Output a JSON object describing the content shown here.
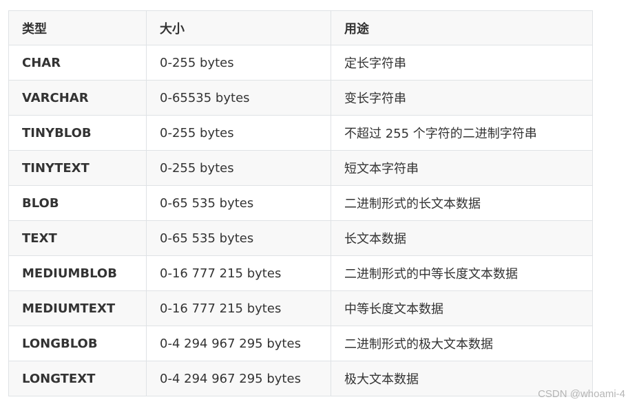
{
  "table": {
    "headers": [
      "类型",
      "大小",
      "用途"
    ],
    "rows": [
      {
        "type": "CHAR",
        "size": "0-255 bytes",
        "usage": "定长字符串"
      },
      {
        "type": "VARCHAR",
        "size": "0-65535 bytes",
        "usage": "变长字符串"
      },
      {
        "type": "TINYBLOB",
        "size": "0-255 bytes",
        "usage": "不超过 255 个字符的二进制字符串"
      },
      {
        "type": "TINYTEXT",
        "size": "0-255 bytes",
        "usage": "短文本字符串"
      },
      {
        "type": "BLOB",
        "size": "0-65 535 bytes",
        "usage": "二进制形式的长文本数据"
      },
      {
        "type": "TEXT",
        "size": "0-65 535 bytes",
        "usage": "长文本数据"
      },
      {
        "type": "MEDIUMBLOB",
        "size": "0-16 777 215 bytes",
        "usage": "二进制形式的中等长度文本数据"
      },
      {
        "type": "MEDIUMTEXT",
        "size": "0-16 777 215 bytes",
        "usage": "中等长度文本数据"
      },
      {
        "type": "LONGBLOB",
        "size": "0-4 294 967 295 bytes",
        "usage": "二进制形式的极大文本数据"
      },
      {
        "type": "LONGTEXT",
        "size": "0-4 294 967 295 bytes",
        "usage": "极大文本数据"
      }
    ]
  },
  "watermark": "CSDN @whoami-4"
}
